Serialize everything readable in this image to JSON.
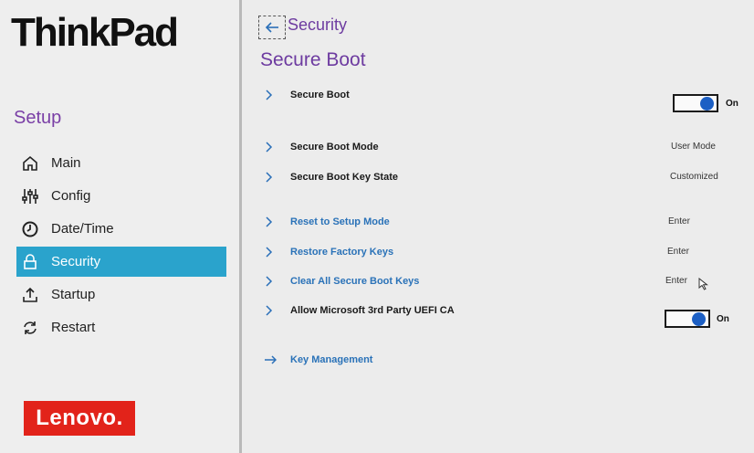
{
  "brand": {
    "thinkpad": "ThinkPad",
    "lenovo": "Lenovo."
  },
  "sidebar": {
    "title": "Setup",
    "items": [
      {
        "label": "Main",
        "icon": "home-icon",
        "active": false
      },
      {
        "label": "Config",
        "icon": "sliders-icon",
        "active": false
      },
      {
        "label": "Date/Time",
        "icon": "clock-icon",
        "active": false
      },
      {
        "label": "Security",
        "icon": "lock-icon",
        "active": true
      },
      {
        "label": "Startup",
        "icon": "upload-icon",
        "active": false
      },
      {
        "label": "Restart",
        "icon": "restart-icon",
        "active": false
      }
    ]
  },
  "header": {
    "breadcrumb": "Security",
    "title": "Secure Boot"
  },
  "settings": [
    {
      "label": "Secure Boot",
      "type": "toggle",
      "value": "On"
    },
    {
      "label": "Secure Boot Mode",
      "type": "info",
      "value": "User Mode"
    },
    {
      "label": "Secure Boot Key State",
      "type": "info",
      "value": "Customized"
    },
    {
      "label": "Reset to Setup Mode",
      "type": "action",
      "value": "Enter"
    },
    {
      "label": "Restore Factory Keys",
      "type": "action",
      "value": "Enter"
    },
    {
      "label": "Clear All Secure Boot Keys",
      "type": "action",
      "value": "Enter"
    },
    {
      "label": "Allow Microsoft 3rd Party UEFI CA",
      "type": "toggle",
      "value": "On"
    },
    {
      "label": "Key Management",
      "type": "nav"
    }
  ],
  "colors": {
    "accent": "#2aa3cc",
    "title_purple": "#6d3ba0",
    "link_blue": "#2a72b8",
    "toggle_knob": "#1c5fc4",
    "lenovo_red": "#e2231a"
  }
}
